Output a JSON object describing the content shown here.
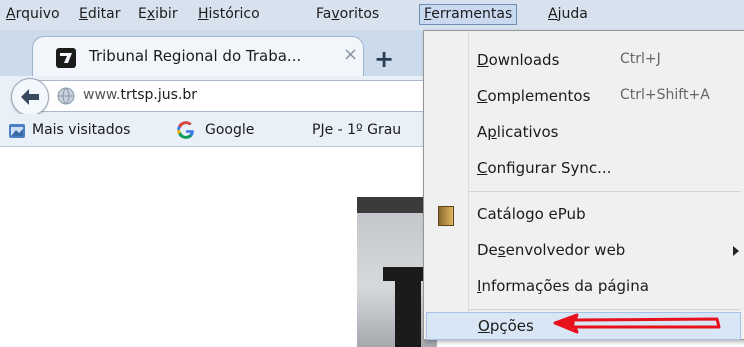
{
  "menubar": {
    "items": [
      {
        "pre": "",
        "ul": "A",
        "post": "rquivo"
      },
      {
        "pre": "",
        "ul": "E",
        "post": "ditar"
      },
      {
        "pre": "E",
        "ul": "x",
        "post": "ibir"
      },
      {
        "pre": "",
        "ul": "H",
        "post": "istórico"
      },
      {
        "pre": "Fa",
        "ul": "v",
        "post": "oritos"
      },
      {
        "pre": "",
        "ul": "F",
        "post": "erramentas"
      },
      {
        "pre": "",
        "ul": "A",
        "post": "juda"
      }
    ]
  },
  "tab": {
    "title": "Tribunal Regional do Traba...",
    "close": "×",
    "new_tab": "+"
  },
  "navbar": {
    "url_prefix": "www.",
    "url_domain": "trtsp.jus.br"
  },
  "bookmarks": {
    "items": [
      "Mais visitados",
      "Google",
      "PJe - 1º Grau"
    ]
  },
  "tools_menu": {
    "items": [
      {
        "pre": "",
        "ul": "D",
        "post": "ownloads",
        "shortcut": "Ctrl+J"
      },
      {
        "pre": "",
        "ul": "C",
        "post": "omplementos",
        "shortcut": "Ctrl+Shift+A"
      },
      {
        "pre": "A",
        "ul": "p",
        "post": "licativos",
        "shortcut": ""
      },
      {
        "pre": "",
        "ul": "C",
        "post": "onfigurar Sync...",
        "shortcut": ""
      },
      {
        "pre": "Catálogo ePub",
        "ul": "",
        "post": "",
        "shortcut": ""
      },
      {
        "pre": "De",
        "ul": "s",
        "post": "envolvedor web",
        "shortcut": ""
      },
      {
        "pre": "",
        "ul": "I",
        "post": "nformações da página",
        "shortcut": ""
      },
      {
        "pre": "",
        "ul": "O",
        "post": "pções",
        "shortcut": ""
      }
    ]
  },
  "colors": {
    "menubar_bg": "#d8e2ee",
    "menu_bg": "#f0f0f0",
    "highlight": "#d9e6f5",
    "annotation_red": "#e8101a"
  }
}
